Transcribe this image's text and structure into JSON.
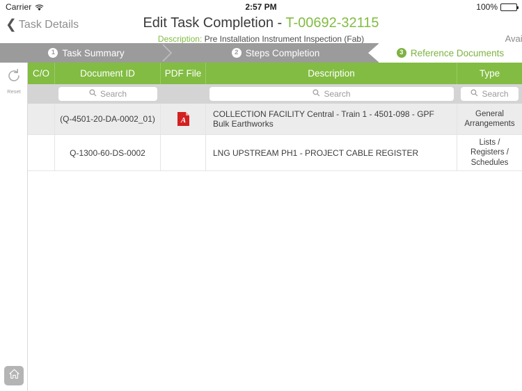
{
  "status_bar": {
    "carrier": "Carrier",
    "wifi_icon": "wifi-icon",
    "time": "2:57 PM",
    "battery_percent": "100%",
    "battery_icon": "battery-full-icon"
  },
  "nav": {
    "back_label": "Task Details",
    "back_icon": "chevron-left-icon",
    "title_prefix": "Edit Task Completion - ",
    "task_id": "T-00692-32115",
    "description_label": "Description:",
    "description_value": "Pre Installation Instrument Inspection (Fab)",
    "available_text": "Availab"
  },
  "steps": [
    {
      "number": "1",
      "label": "Task Summary",
      "active": false
    },
    {
      "number": "2",
      "label": "Steps Completion",
      "active": false
    },
    {
      "number": "3",
      "label": "Reference Documents",
      "active": true
    }
  ],
  "rail": {
    "reset_label": "Reset",
    "reset_icon": "refresh-icon",
    "home_icon": "home-icon"
  },
  "table": {
    "columns": [
      {
        "key": "co",
        "label": "C/O",
        "searchable": false
      },
      {
        "key": "doc",
        "label": "Document ID",
        "searchable": true
      },
      {
        "key": "pdf",
        "label": "PDF File",
        "searchable": false
      },
      {
        "key": "desc",
        "label": "Description",
        "searchable": true
      },
      {
        "key": "type",
        "label": "Type",
        "searchable": true
      }
    ],
    "search_placeholder": "Search",
    "search_icon": "search-icon",
    "rows": [
      {
        "co": "",
        "doc": "(Q-4501-20-DA-0002_01)",
        "pdf_icon": "pdf-file-icon",
        "has_pdf": true,
        "desc": "COLLECTION FACILITY Central - Train 1 - 4501-098 - GPF Bulk Earthworks",
        "type": "General Arrangements"
      },
      {
        "co": "",
        "doc": "Q-1300-60-DS-0002",
        "pdf_icon": "",
        "has_pdf": false,
        "desc": "LNG UPSTREAM PH1 - PROJECT CABLE REGISTER",
        "type": "Lists / Registers / Schedules"
      }
    ]
  },
  "watermark": {
    "name": "gears-lightbulb-watermark"
  },
  "colors": {
    "brand_green": "#82bc42",
    "step_inactive": "#9b9b9b",
    "filter_bg": "#d4d4d4",
    "row_alt": "#ececec",
    "pdf_red": "#d32021"
  }
}
